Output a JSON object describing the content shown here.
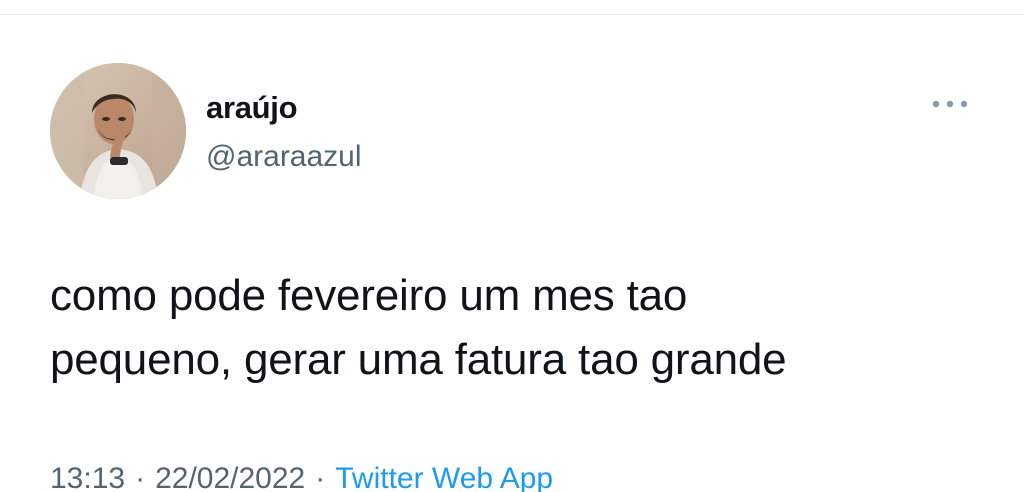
{
  "tweet": {
    "author": {
      "display_name": "araújo",
      "handle": "@araraazul"
    },
    "text_lines": [
      "como pode fevereiro um mes tao",
      "pequeno, gerar uma fatura tao grande"
    ],
    "meta": {
      "time": "13:13",
      "separator": "·",
      "date": "22/02/2022",
      "source": "Twitter Web App"
    },
    "more_icon": "more-horizontal-icon"
  },
  "colors": {
    "text_primary": "#0f1419",
    "text_secondary": "#536471",
    "link": "#1d9bf0",
    "divider": "#e6e9ea"
  }
}
